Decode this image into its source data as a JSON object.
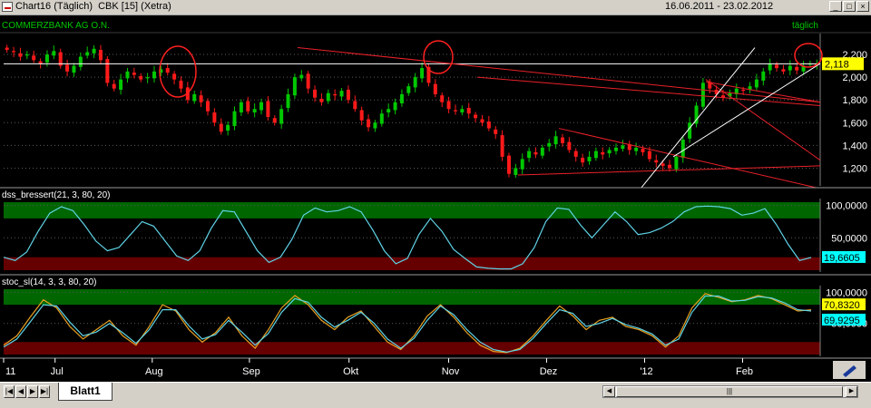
{
  "window": {
    "title": "Chart16 (Täglich)  CBK [15] (Xetra)",
    "date_range": "16.06.2011 - 23.02.2012",
    "buttons": [
      "_",
      "□",
      "×"
    ]
  },
  "sheet": {
    "tab": "Blatt1"
  },
  "colors": {
    "background": "#000000",
    "grid": "#5a5a5a",
    "candle_up": "#00c800",
    "candle_down": "#ff1a1a",
    "trendline_red": "#e8212a",
    "trendline_white": "#ffffff",
    "oscillator_line": "#5fd3e6",
    "stoch_k": "#e8a020",
    "stoch_d": "#5fd3e6",
    "overbought_zone": "#006600",
    "oversold_zone": "#660000",
    "price_label_bg": "#ffff00",
    "osc_label_bg": "#00ffff"
  },
  "chart_data": [
    {
      "type": "candlestick",
      "name": "COMMERZBANK AG O.N.",
      "interval_label": "täglich",
      "last_price_label": "2,118",
      "y_ticks": [
        "2,200",
        "2,000",
        "1,800",
        "1,600",
        "1,400",
        "1,200"
      ],
      "y_tick_values": [
        2.2,
        2.0,
        1.8,
        1.6,
        1.4,
        1.2
      ],
      "ylim": [
        1.06,
        2.32
      ],
      "x_ticks": [
        "11",
        "Jul",
        "Aug",
        "Sep",
        "Okt",
        "Nov",
        "Dez",
        "'12",
        "Feb"
      ],
      "x_range": [
        "2011-06-16",
        "2012-02-23"
      ],
      "approx_closes": [
        2.24,
        2.22,
        2.18,
        2.2,
        2.15,
        2.12,
        2.2,
        2.23,
        2.1,
        2.05,
        2.1,
        2.18,
        2.22,
        2.25,
        2.15,
        1.95,
        1.9,
        1.98,
        2.05,
        2.02,
        1.98,
        2.0,
        2.05,
        2.07,
        2.04,
        1.98,
        1.9,
        1.8,
        1.85,
        1.78,
        1.7,
        1.6,
        1.52,
        1.58,
        1.7,
        1.78,
        1.7,
        1.72,
        1.78,
        1.65,
        1.6,
        1.72,
        1.85,
        2.0,
        2.02,
        1.9,
        1.82,
        1.78,
        1.86,
        1.84,
        1.88,
        1.8,
        1.72,
        1.62,
        1.56,
        1.6,
        1.68,
        1.72,
        1.78,
        1.85,
        1.92,
        2.0,
        2.08,
        1.95,
        1.85,
        1.78,
        1.72,
        1.7,
        1.72,
        1.68,
        1.64,
        1.6,
        1.55,
        1.5,
        1.3,
        1.15,
        1.2,
        1.28,
        1.35,
        1.32,
        1.38,
        1.42,
        1.48,
        1.42,
        1.36,
        1.3,
        1.25,
        1.3,
        1.35,
        1.32,
        1.36,
        1.38,
        1.4,
        1.36,
        1.38,
        1.34,
        1.28,
        1.25,
        1.22,
        1.2,
        1.3,
        1.45,
        1.6,
        1.75,
        1.95,
        1.9,
        1.85,
        1.82,
        1.86,
        1.9,
        1.88,
        1.92,
        1.98,
        2.05,
        2.12,
        2.08,
        2.05,
        2.1,
        2.06,
        2.1,
        2.12,
        2.118
      ],
      "trendlines": [
        {
          "color": "red",
          "from": [
            0.36,
            2.26
          ],
          "to": [
            1.0,
            1.78
          ]
        },
        {
          "color": "red",
          "from": [
            0.58,
            2.0
          ],
          "to": [
            1.0,
            1.75
          ]
        },
        {
          "color": "red",
          "from": [
            0.63,
            1.14
          ],
          "to": [
            1.0,
            1.22
          ]
        },
        {
          "color": "red",
          "from": [
            0.68,
            1.55
          ],
          "to": [
            1.0,
            1.02
          ]
        },
        {
          "color": "red",
          "from": [
            0.86,
            1.98
          ],
          "to": [
            1.0,
            1.27
          ]
        },
        {
          "color": "red",
          "from": [
            0.86,
            1.96
          ],
          "to": [
            1.0,
            1.78
          ]
        },
        {
          "color": "white",
          "from": [
            0.78,
            1.02
          ],
          "to": [
            0.92,
            2.26
          ]
        },
        {
          "color": "white",
          "from": [
            0.82,
            1.3
          ],
          "to": [
            1.0,
            2.12
          ]
        }
      ]
    },
    {
      "type": "line",
      "name": "dss_bressert(21, 3, 80, 20)",
      "y_ticks": [
        "100,0000",
        "50,0000"
      ],
      "y_tick_values": [
        100,
        50
      ],
      "ylim": [
        0,
        105
      ],
      "zones": {
        "overbought": 80,
        "oversold": 20
      },
      "last_value_label": "19,6605",
      "values": [
        20,
        15,
        28,
        60,
        88,
        98,
        92,
        70,
        45,
        30,
        35,
        55,
        75,
        68,
        45,
        22,
        15,
        30,
        65,
        92,
        90,
        60,
        30,
        12,
        20,
        48,
        85,
        96,
        90,
        92,
        98,
        90,
        62,
        30,
        10,
        18,
        55,
        80,
        60,
        32,
        18,
        5,
        3,
        2,
        2,
        10,
        35,
        75,
        96,
        94,
        70,
        50,
        70,
        90,
        75,
        55,
        58,
        65,
        75,
        90,
        98,
        99,
        98,
        95,
        85,
        88,
        95,
        70,
        40,
        15,
        19.66
      ]
    },
    {
      "type": "line",
      "name": "stoc_sl(14, 3, 3, 80, 20)",
      "y_ticks": [
        "100,0000",
        "50,0000"
      ],
      "y_tick_values": [
        100,
        50
      ],
      "ylim": [
        0,
        105
      ],
      "zones": {
        "overbought": 80,
        "oversold": 20
      },
      "last_value_labels": [
        "70,8320",
        "69,9295"
      ],
      "series": [
        {
          "values": [
            15,
            30,
            60,
            88,
            75,
            45,
            25,
            40,
            55,
            30,
            15,
            45,
            80,
            70,
            40,
            20,
            35,
            60,
            30,
            10,
            40,
            75,
            95,
            80,
            55,
            40,
            60,
            70,
            45,
            20,
            8,
            30,
            62,
            80,
            60,
            35,
            15,
            5,
            3,
            10,
            30,
            55,
            78,
            62,
            40,
            55,
            60,
            45,
            40,
            30,
            12,
            30,
            75,
            98,
            92,
            85,
            88,
            95,
            90,
            80,
            70,
            72
          ]
        },
        {
          "values": [
            12,
            25,
            52,
            80,
            78,
            52,
            30,
            36,
            50,
            35,
            18,
            40,
            72,
            72,
            46,
            25,
            32,
            55,
            36,
            15,
            34,
            68,
            90,
            84,
            60,
            44,
            55,
            68,
            50,
            25,
            10,
            26,
            55,
            78,
            64,
            40,
            20,
            8,
            4,
            8,
            26,
            50,
            72,
            66,
            45,
            50,
            58,
            48,
            42,
            33,
            15,
            25,
            68,
            94,
            94,
            86,
            87,
            93,
            91,
            83,
            72,
            69.93
          ]
        }
      ]
    }
  ]
}
